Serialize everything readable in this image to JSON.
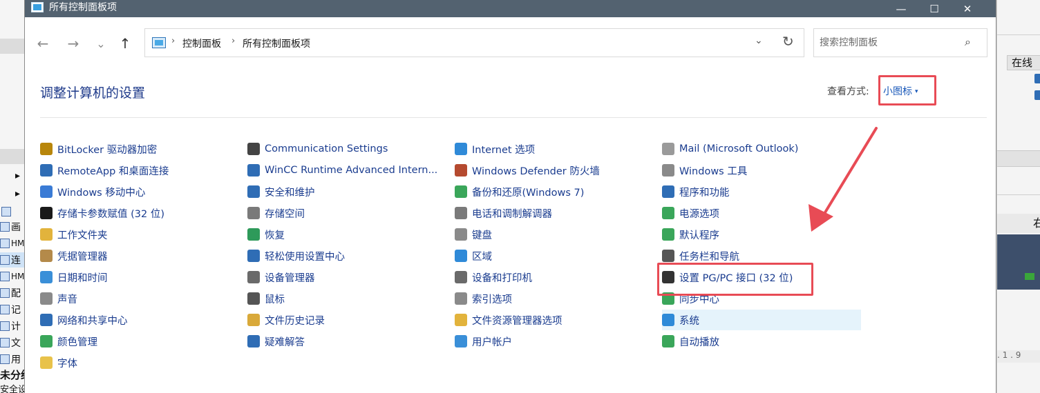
{
  "window": {
    "title": "所有控制面板项",
    "minimize_glyph": "—",
    "maximize_glyph": "☐",
    "close_glyph": "✕"
  },
  "nav": {
    "back_glyph": "←",
    "forward_glyph": "→",
    "recent_glyph": "⌄",
    "up_glyph": "↑",
    "crumb_sep": "›",
    "breadcrumb": [
      "控制面板",
      "所有控制面板项"
    ],
    "address_dropdown_glyph": "⌄",
    "refresh_glyph": "↻",
    "search_placeholder": "搜索控制面板",
    "search_glyph": "⌕"
  },
  "content": {
    "heading": "调整计算机的设置",
    "view_by_label": "查看方式:",
    "view_by_value": "小图标",
    "view_by_caret": "▾"
  },
  "columns": [
    [
      {
        "label": "BitLocker 驱动器加密",
        "icon": "key-drive-icon",
        "color": "#b8860b"
      },
      {
        "label": "RemoteApp 和桌面连接",
        "icon": "remote-desktop-icon",
        "color": "#2f6db5"
      },
      {
        "label": "Windows 移动中心",
        "icon": "mobility-center-icon",
        "color": "#3a7bd5"
      },
      {
        "label": "存储卡参数赋值 (32 位)",
        "icon": "memory-card-icon",
        "color": "#1a1a1a"
      },
      {
        "label": "工作文件夹",
        "icon": "work-folder-icon",
        "color": "#e2b33c"
      },
      {
        "label": "凭据管理器",
        "icon": "credential-icon",
        "color": "#b48a4a"
      },
      {
        "label": "日期和时间",
        "icon": "clock-icon",
        "color": "#3a8fd8"
      },
      {
        "label": "声音",
        "icon": "speaker-icon",
        "color": "#8a8a8a"
      },
      {
        "label": "网络和共享中心",
        "icon": "network-icon",
        "color": "#2f6db5"
      },
      {
        "label": "颜色管理",
        "icon": "color-icon",
        "color": "#3aa65a"
      },
      {
        "label": "字体",
        "icon": "font-icon",
        "color": "#e8c24a"
      }
    ],
    [
      {
        "label": "Communication Settings",
        "icon": "com-set-icon",
        "color": "#444444"
      },
      {
        "label": "WinCC Runtime Advanced Intern...",
        "icon": "wincc-icon",
        "color": "#2f6db5"
      },
      {
        "label": "安全和维护",
        "icon": "flag-icon",
        "color": "#2f6db5"
      },
      {
        "label": "存储空间",
        "icon": "storage-icon",
        "color": "#7a7a7a"
      },
      {
        "label": "恢复",
        "icon": "recovery-icon",
        "color": "#2e9a5a"
      },
      {
        "label": "轻松使用设置中心",
        "icon": "ease-access-icon",
        "color": "#2f6db5"
      },
      {
        "label": "设备管理器",
        "icon": "device-manager-icon",
        "color": "#6a6a6a"
      },
      {
        "label": "鼠标",
        "icon": "mouse-icon",
        "color": "#555555"
      },
      {
        "label": "文件历史记录",
        "icon": "file-history-icon",
        "color": "#d9a93a"
      },
      {
        "label": "疑难解答",
        "icon": "troubleshoot-icon",
        "color": "#2f6db5"
      }
    ],
    [
      {
        "label": "Internet 选项",
        "icon": "internet-icon",
        "color": "#2f8ad8"
      },
      {
        "label": "Windows Defender 防火墙",
        "icon": "firewall-icon",
        "color": "#b54a2f"
      },
      {
        "label": "备份和还原(Windows 7)",
        "icon": "backup-icon",
        "color": "#3aa65a"
      },
      {
        "label": "电话和调制解调器",
        "icon": "phone-icon",
        "color": "#7a7a7a"
      },
      {
        "label": "键盘",
        "icon": "keyboard-icon",
        "color": "#8a8a8a"
      },
      {
        "label": "区域",
        "icon": "region-icon",
        "color": "#2f8ad8"
      },
      {
        "label": "设备和打印机",
        "icon": "printer-icon",
        "color": "#6a6a6a"
      },
      {
        "label": "索引选项",
        "icon": "index-icon",
        "color": "#8a8a8a"
      },
      {
        "label": "文件资源管理器选项",
        "icon": "folder-options-icon",
        "color": "#e2b33c"
      },
      {
        "label": "用户帐户",
        "icon": "user-accounts-icon",
        "color": "#3a8fd8"
      }
    ],
    [
      {
        "label": "Mail (Microsoft Outlook)",
        "icon": "mail-icon",
        "color": "#9a9a9a"
      },
      {
        "label": "Windows 工具",
        "icon": "tools-icon",
        "color": "#8a8a8a"
      },
      {
        "label": "程序和功能",
        "icon": "programs-icon",
        "color": "#2f6db5"
      },
      {
        "label": "电源选项",
        "icon": "power-icon",
        "color": "#3aa65a"
      },
      {
        "label": "默认程序",
        "icon": "default-programs-icon",
        "color": "#3aa65a"
      },
      {
        "label": "任务栏和导航",
        "icon": "taskbar-icon",
        "color": "#555555"
      },
      {
        "label": "设置 PG/PC 接口 (32 位)",
        "icon": "pgpc-interface-icon",
        "color": "#333333"
      },
      {
        "label": "同步中心",
        "icon": "sync-icon",
        "color": "#3aa65a"
      },
      {
        "label": "系统",
        "icon": "system-icon",
        "color": "#2f8ad8",
        "highlighted": true
      },
      {
        "label": "自动播放",
        "icon": "autoplay-icon",
        "color": "#3aa65a"
      }
    ]
  ],
  "background_app": {
    "left_rows": [
      "画",
      "HM",
      "连",
      "HM",
      "配",
      "记",
      "计",
      "文",
      "用",
      "未分组",
      "安全设"
    ],
    "right_header": "在线",
    "right_tab": "右",
    "ruler_text": ". 1 . 9"
  },
  "annotation_color": "#e84b55"
}
